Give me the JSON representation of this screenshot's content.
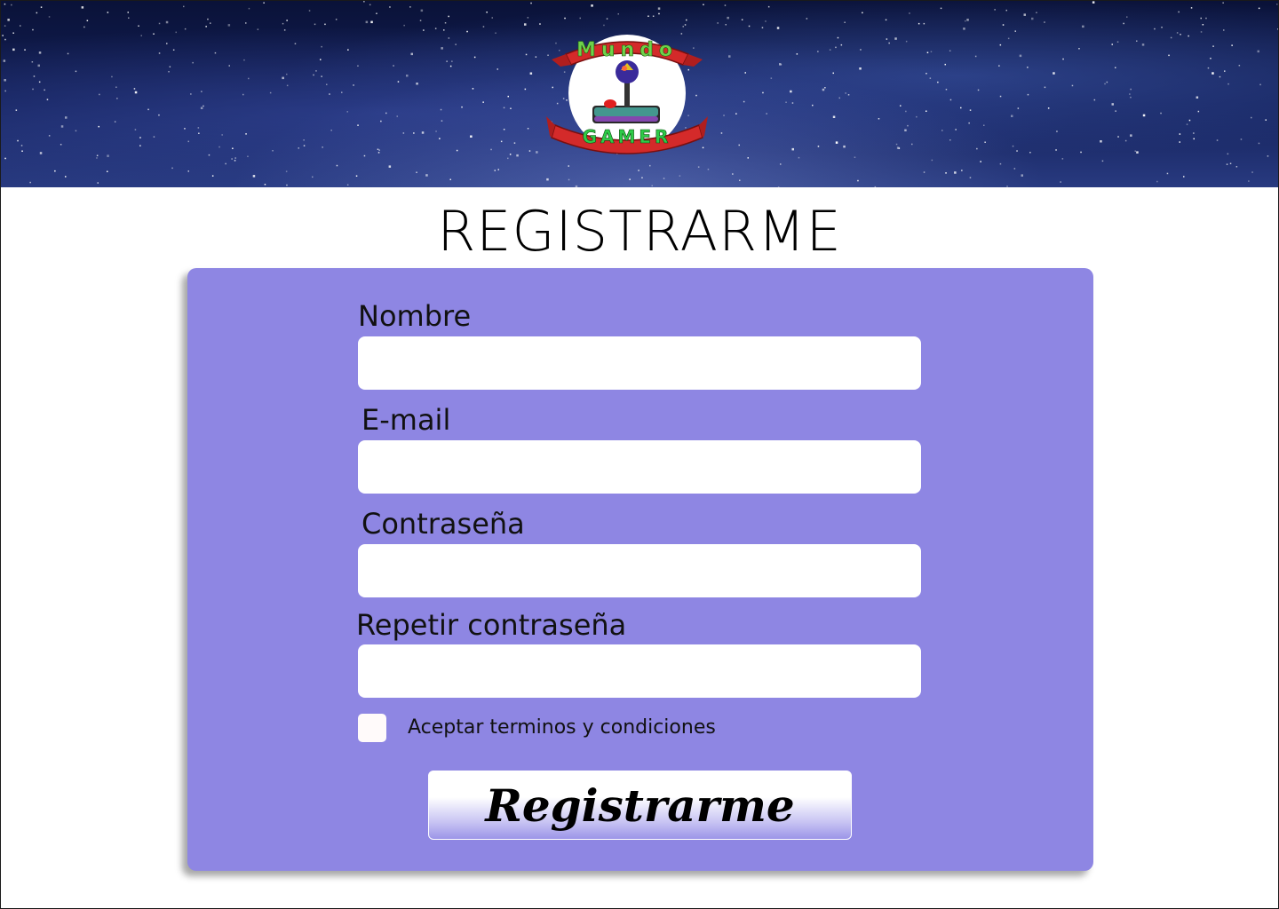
{
  "header": {
    "logo": {
      "icon": "joystick-icon",
      "banner_top_text": "Mundo",
      "banner_bottom_text": "GAMER"
    }
  },
  "page_title": "REGISTRARME",
  "form": {
    "fields": [
      {
        "label": "Nombre",
        "value": "",
        "placeholder": ""
      },
      {
        "label": "E-mail",
        "value": "",
        "placeholder": ""
      },
      {
        "label": "Contraseña",
        "value": "",
        "placeholder": ""
      },
      {
        "label": "Repetir contraseña",
        "value": "",
        "placeholder": ""
      }
    ],
    "terms_label": "Aceptar terminos y condiciones",
    "terms_checked": false,
    "submit_label": "Registrarme"
  },
  "colors": {
    "card_background": "#8e86e3",
    "header_sky": "#132058",
    "banner_red": "#d42a2a"
  }
}
